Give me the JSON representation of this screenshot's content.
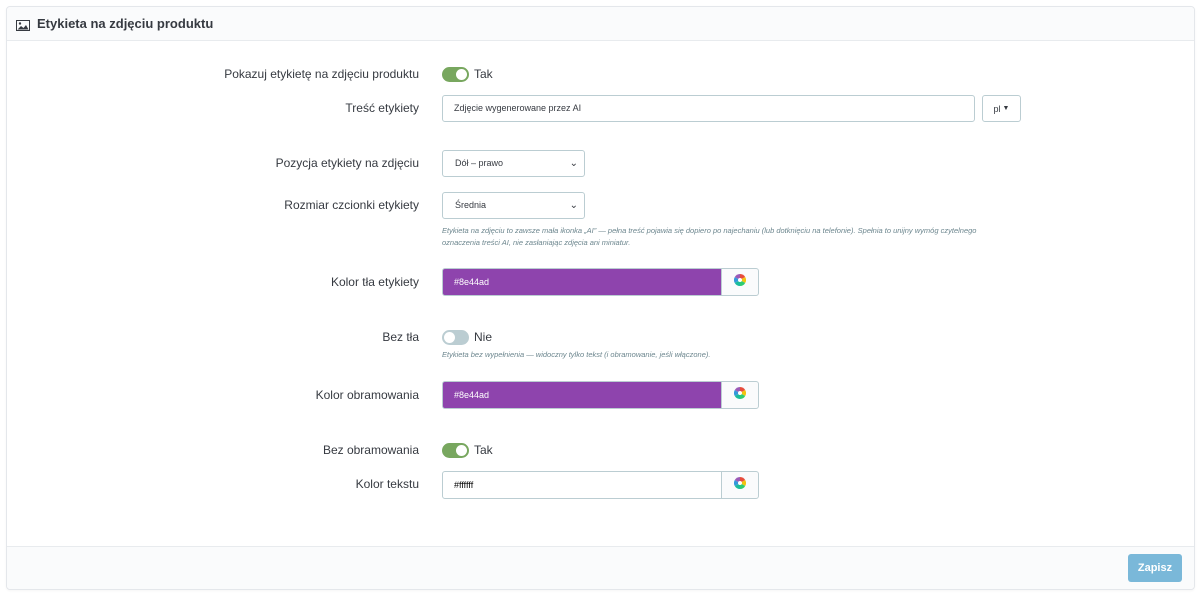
{
  "panel": {
    "title": "Etykieta na zdjęciu produktu",
    "icon": "image-icon"
  },
  "fields": {
    "show_label": {
      "label": "Pokazuj etykietę na zdjęciu produktu",
      "value": "Tak",
      "on": true
    },
    "label_text": {
      "label": "Treść etykiety",
      "value": "Zdjęcie wygenerowane przez AI",
      "lang": "pl"
    },
    "position": {
      "label": "Pozycja etykiety na zdjęciu",
      "selected": "Dół – prawo"
    },
    "font_size": {
      "label": "Rozmiar czcionki etykiety",
      "selected": "Średnia",
      "help_line1": "Etykieta na zdjęciu to zawsze mała ikonka „AI” — pełna treść pojawia się dopiero po najechaniu (lub dotknięciu na telefonie). Spełnia to unijny wymóg czytelnego",
      "help_line2": "oznaczenia treści AI, nie zasłaniając zdjęcia ani miniatur."
    },
    "bg_color": {
      "label": "Kolor tła etykiety",
      "value": "#8e44ad",
      "swatch": "#8e44ad"
    },
    "no_bg": {
      "label": "Bez tła",
      "value": "Nie",
      "on": false,
      "help": "Etykieta bez wypełnienia — widoczny tylko tekst (i obramowanie, jeśli włączone)."
    },
    "border_color": {
      "label": "Kolor obramowania",
      "value": "#8e44ad",
      "swatch": "#8e44ad"
    },
    "no_border": {
      "label": "Bez obramowania",
      "value": "Tak",
      "on": true
    },
    "text_color": {
      "label": "Kolor tekstu",
      "value": "#ffffff",
      "swatch": "#ffffff"
    }
  },
  "footer": {
    "save_label": "Zapisz"
  },
  "colors": {
    "switch_on": "#78a75f",
    "switch_off": "#bbcdd2",
    "save_button": "#7ab8d9"
  }
}
